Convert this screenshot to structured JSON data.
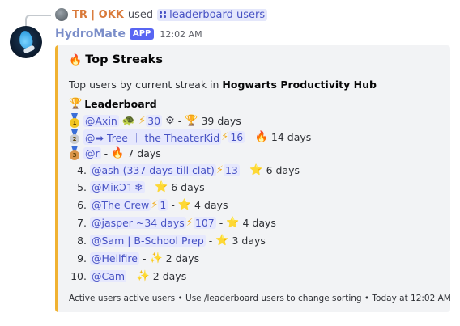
{
  "reply": {
    "user": "TR | OKK",
    "used": "used",
    "command": "leaderboard users"
  },
  "message": {
    "bot_name": "HydroMate",
    "badge": "APP",
    "timestamp": "12:02 AM"
  },
  "embed": {
    "accent_color": "#f0b232",
    "title": "Top Streaks",
    "desc_prefix": "Top users by current streak in ",
    "server_name": "Hogwarts Productivity Hub",
    "leaderboard_title": "Leaderboard",
    "footer": "Active users active users • Use /leaderboard users to change sorting • Today at 12:02 AM"
  },
  "rows": [
    {
      "rank": "1",
      "medal": "gold",
      "user": "@Axin",
      "extra": "30",
      "badge": "🏆",
      "days": "39 days"
    },
    {
      "rank": "2",
      "medal": "silver",
      "user": "@➡ Tree ｜ the TheaterKid",
      "extra": "16",
      "badge": "🔥",
      "days": "14 days"
    },
    {
      "rank": "3",
      "medal": "bronze",
      "user": "@r",
      "badge": "🔥",
      "days": "7 days"
    },
    {
      "rank": "4.",
      "user": "@ash (337 days till clat)",
      "extra": "13",
      "badge": "⭐",
      "days": "6 days"
    },
    {
      "rank": "5.",
      "user": "@MiκƆ˥ ❄",
      "badge": "⭐",
      "days": "6 days"
    },
    {
      "rank": "6.",
      "user": "@The Crew",
      "extra": "1",
      "badge": "⭐",
      "days": "4 days"
    },
    {
      "rank": "7.",
      "user": "@jasper ~34 days",
      "extra": "107",
      "badge": "⭐",
      "days": "4 days"
    },
    {
      "rank": "8.",
      "user": "@Sam | B-School Prep",
      "badge": "⭐",
      "days": "3 days"
    },
    {
      "rank": "9.",
      "user": "@Hellfire",
      "badge": "✨",
      "days": "2 days"
    },
    {
      "rank": "10.",
      "user": "@Cam",
      "badge": "✨",
      "days": "2 days"
    }
  ],
  "symbols": {
    "bolt": "⚡",
    "fire": "🔥",
    "trophy": "🏆",
    "turtle": "🐢",
    "gear": "⚙",
    "dash": "-",
    "medal_1": "1",
    "medal_2": "2",
    "medal_3": "3"
  }
}
